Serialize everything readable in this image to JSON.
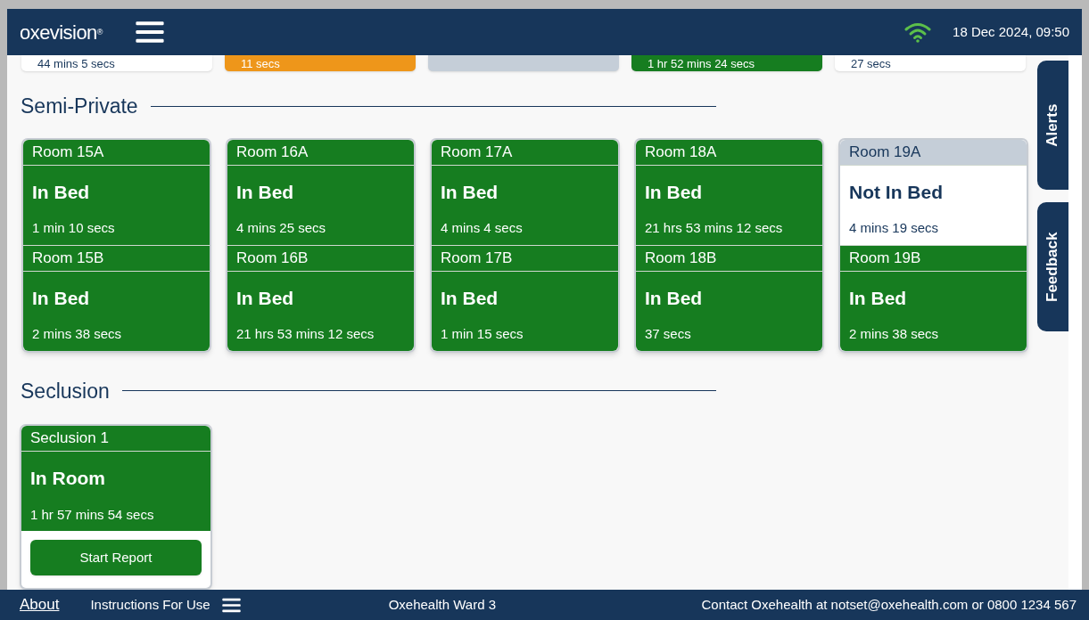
{
  "header": {
    "logo": "oxevision",
    "logo_mark": "®",
    "datetime": "18 Dec 2024, 09:50"
  },
  "partial_cards": [
    {
      "kind": "white",
      "time": "44 mins 5 secs"
    },
    {
      "kind": "orange",
      "time": "11 secs"
    },
    {
      "kind": "grey"
    },
    {
      "kind": "green",
      "time": "1 hr 52 mins 24 secs"
    },
    {
      "kind": "white",
      "time": "27 secs"
    }
  ],
  "sections": [
    {
      "title": "Semi-Private",
      "cards": [
        {
          "rooms": [
            {
              "name": "Room 15A",
              "status": "In Bed",
              "kind": "in_bed",
              "time": "1 min 10 secs"
            },
            {
              "name": "Room 15B",
              "status": "In Bed",
              "kind": "in_bed",
              "time": "2 mins 38 secs"
            }
          ]
        },
        {
          "rooms": [
            {
              "name": "Room 16A",
              "status": "In Bed",
              "kind": "in_bed",
              "time": "4 mins 25 secs"
            },
            {
              "name": "Room 16B",
              "status": "In Bed",
              "kind": "in_bed",
              "time": "21 hrs 53 mins 12 secs"
            }
          ]
        },
        {
          "rooms": [
            {
              "name": "Room 17A",
              "status": "In Bed",
              "kind": "in_bed",
              "time": "4 mins 4 secs"
            },
            {
              "name": "Room 17B",
              "status": "In Bed",
              "kind": "in_bed",
              "time": "1 min 15 secs"
            }
          ]
        },
        {
          "rooms": [
            {
              "name": "Room 18A",
              "status": "In Bed",
              "kind": "in_bed",
              "time": "21 hrs 53 mins 12 secs"
            },
            {
              "name": "Room 18B",
              "status": "In Bed",
              "kind": "in_bed",
              "time": "37 secs"
            }
          ]
        },
        {
          "rooms": [
            {
              "name": "Room 19A",
              "status": "Not In Bed",
              "kind": "not_in_bed",
              "time": "4 mins 19 secs"
            },
            {
              "name": "Room 19B",
              "status": "In Bed",
              "kind": "in_bed",
              "time": "2 mins 38 secs"
            }
          ]
        }
      ]
    },
    {
      "title": "Seclusion",
      "cards": [
        {
          "rooms": [
            {
              "name": "Seclusion 1",
              "status": "In Room",
              "kind": "in_bed",
              "time": "1 hr 57 mins 54 secs"
            }
          ],
          "button": "Start Report"
        }
      ]
    }
  ],
  "side_tabs": [
    "Alerts",
    "Feedback"
  ],
  "footer": {
    "about": "About",
    "instructions": "Instructions For Use",
    "ward": "Oxehealth Ward 3",
    "contact": "Contact Oxehealth at notset@oxehealth.com or 0800 1234 567"
  }
}
